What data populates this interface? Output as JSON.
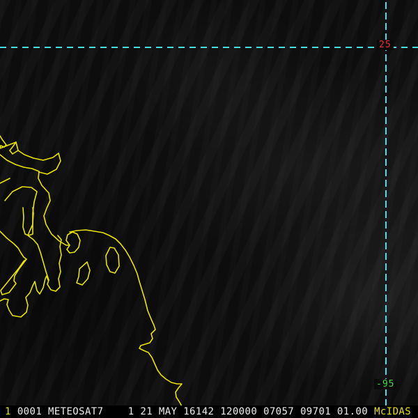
{
  "app": {
    "name": "McIDAS satellite image display"
  },
  "colors": {
    "coastline": "#e8e400",
    "grid": "#45e0e4",
    "lat_label": "#f03030",
    "lon_label": "#3ddc3d",
    "status_text": "#ededed",
    "status_accent": "#e8e000"
  },
  "grid": {
    "lat_label": "25",
    "lon_label": "-95"
  },
  "status_bar": {
    "frame_number": "1",
    "text": "0001 METEOSAT7    1 21 MAY 16142 120000 07057 09701 01.00",
    "brand": "McIDAS"
  },
  "overlay": {
    "coastline_paths": [
      "M0,195 L3,200 L9,208 L6,211 L1,209 L0,212",
      "M0,213 L23,204 L26,216 L35,222 L48,227 L62,230 L76,226 L84,220",
      "M23,204 L18,211 L14,216 L18,221 L26,216",
      "M84,220 L87,231 L81,243 L68,250 L56,247",
      "M0,222 L10,230 L22,236 L34,240 L46,242 L56,246 L55,256 L60,266 L70,277 L72,288 L67,299 L63,310 L66,322 L74,336 L85,346 L95,352 L100,352",
      "M0,263 L8,259 L14,256",
      "M7,288 L18,275 L32,268 L45,269 L53,275 L49,290 L47,306 L47,322 L42,333 L40,338 L48,344 L54,351 L58,362 L62,376 L66,390 L70,402 L68,408 L73,416 L80,418 L86,412 L84,400 L87,390 L85,378 L88,366 L86,354 L88,344 L83,338",
      "M33,298 L34,312 L33,326 L36,336 L41,338 L47,336 L47,320 L48,306 L47,298",
      "M100,352 L95,345 L97,337 L104,333 L111,336 L115,345 L113,355 L107,362 L100,363 L96,358 L100,352",
      "M100,333 L110,331 L123,330 L136,332 L148,334 L157,338 L166,343 L173,350 L180,359 L186,369 L192,381 L197,393 L200,404 L204,417 L208,430 L212,446 L217,458 L221,467 L223,473 L217,479 L219,486 L215,492 L202,496 L200,500 L206,503 L213,506 L218,513 L222,522 L226,531 L231,538 L238,544 L246,549 L254,551 L261,551 L256,557 L252,563 L253,570 L257,576 L261,583",
      "M125,376 L114,386 L113,397 L110,406 L118,409 L126,400 L129,388 L125,376",
      "M158,355 L152,367 L153,380 L158,390 L165,392 L171,382 L170,366 L164,356 L158,355",
      "M0,332 L10,342 L20,350 L26,356 L30,363 L34,369 L38,372",
      "M38,372 L28,385 L21,396 L20,403 L23,407 L13,420 L3,423 L1,417 L10,406 L18,396 L27,385 L34,375 L38,372",
      "M0,432 L6,429 L12,430 L10,437 L13,445 L18,453 L30,455 L38,448 L40,438 L37,427 L43,420 L47,410 L50,404 L53,417 L57,422 L62,413 L65,400 L67,396 L69,402"
    ]
  }
}
